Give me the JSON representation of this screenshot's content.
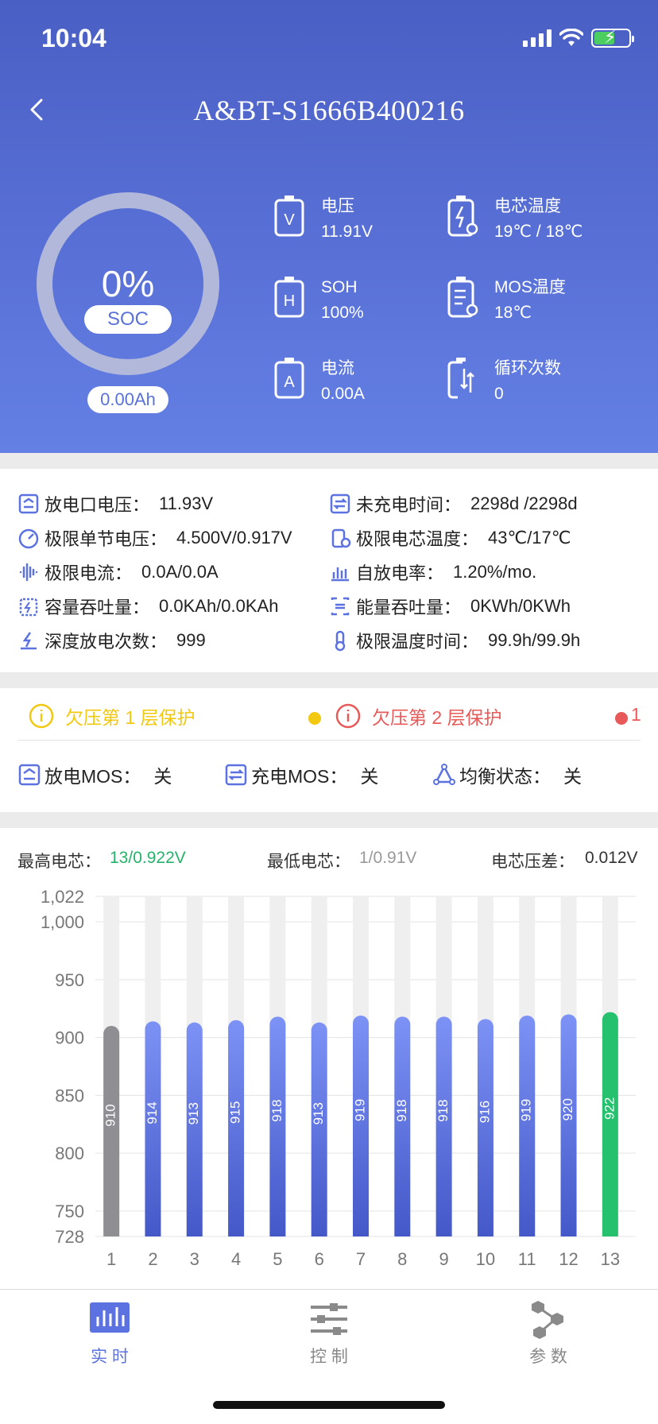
{
  "status_bar": {
    "time": "10:04"
  },
  "nav": {
    "title": "A&BT-S1666B400216"
  },
  "soc": {
    "percent_text": "0%",
    "percent": 0,
    "label": "SOC",
    "capacity": "0.00Ah"
  },
  "metrics": [
    {
      "icon": "voltage-icon",
      "label": "电压",
      "value": "11.91V"
    },
    {
      "icon": "cell-temp-icon",
      "label": "电芯温度",
      "value": "19℃ / 18℃"
    },
    {
      "icon": "soh-icon",
      "label": "SOH",
      "value": "100%"
    },
    {
      "icon": "mos-temp-icon",
      "label": "MOS温度",
      "value": "18℃"
    },
    {
      "icon": "current-icon",
      "label": "电流",
      "value": "0.00A"
    },
    {
      "icon": "cycle-icon",
      "label": "循环次数",
      "value": "0"
    }
  ],
  "info": [
    {
      "label": "放电口电压：",
      "value": "11.93V"
    },
    {
      "label": "未充电时间：",
      "value": "2298d /2298d"
    },
    {
      "label": "极限单节电压：",
      "value": "4.500V/0.917V"
    },
    {
      "label": "极限电芯温度：",
      "value": "43℃/17℃"
    },
    {
      "label": "极限电流：",
      "value": "0.0A/0.0A"
    },
    {
      "label": "自放电率：",
      "value": "1.20%/mo."
    },
    {
      "label": "容量吞吐量：",
      "value": "0.0KAh/0.0KAh"
    },
    {
      "label": "能量吞吐量：",
      "value": "0KWh/0KWh"
    },
    {
      "label": "深度放电次数：",
      "value": "999"
    },
    {
      "label": "极限温度时间：",
      "value": "99.9h/99.9h"
    }
  ],
  "protection": {
    "level1": {
      "label": "欠压第 1 层保护",
      "color": "#f2c811"
    },
    "level2": {
      "label": "欠压第 2 层保护",
      "color": "#e85a5a",
      "count": "1"
    }
  },
  "mos_status": [
    {
      "label": "放电MOS：",
      "value": "关"
    },
    {
      "label": "充电MOS：",
      "value": "关"
    },
    {
      "label": "均衡状态：",
      "value": "关"
    }
  ],
  "cell_stats": {
    "max_label": "最高电芯：",
    "max_value": "13/0.922V",
    "min_label": "最低电芯：",
    "min_value": "1/0.91V",
    "diff_label": "电芯压差：",
    "diff_value": "0.012V"
  },
  "chart_data": {
    "type": "bar",
    "categories": [
      "1",
      "2",
      "3",
      "4",
      "5",
      "6",
      "7",
      "8",
      "9",
      "10",
      "11",
      "12",
      "13"
    ],
    "values": [
      910,
      914,
      913,
      915,
      918,
      913,
      919,
      918,
      918,
      916,
      919,
      920,
      922
    ],
    "ylim": [
      728,
      1022
    ],
    "yticks": [
      728,
      750,
      800,
      850,
      900,
      950,
      1000,
      1022
    ],
    "ytick_labels": [
      "728",
      "750",
      "800",
      "850",
      "900",
      "950",
      "1,000",
      "1,022"
    ],
    "grid": true,
    "colors": {
      "normal": "#5b72e0",
      "min": "#8e8e93",
      "max": "#25c16f",
      "track": "#efefef"
    }
  },
  "tabs": [
    {
      "label": "实 时",
      "active": true
    },
    {
      "label": "控 制",
      "active": false
    },
    {
      "label": "参 数",
      "active": false
    }
  ]
}
